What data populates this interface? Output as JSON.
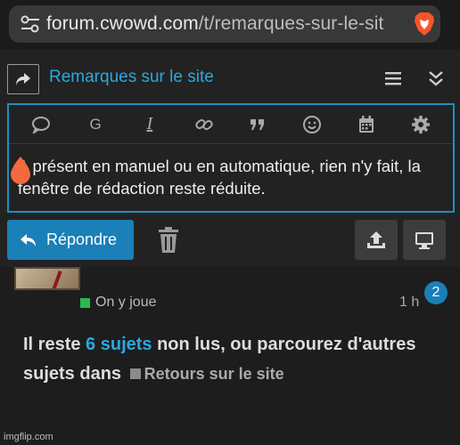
{
  "browser": {
    "url_domain": "forum.cwowd.com",
    "url_path": "/t/remarques-sur-le-sit",
    "icons": [
      "tune-icon",
      "brave-lion-icon"
    ]
  },
  "composer": {
    "topic_title": "Remarques sur le site",
    "header_icons": [
      "reply-arrow-icon",
      "menu-icon",
      "collapse-icon"
    ],
    "toolbar": {
      "items": [
        "quote-icon",
        "G",
        "I",
        "link-icon",
        "blockquote-icon",
        "emoji-icon",
        "calendar-icon",
        "gear-icon"
      ],
      "g_label": "G",
      "i_label": "I"
    },
    "body_text": "A présent en manuel ou en automatique, rien n'y fait, la fenêtre de rédaction reste réduite.",
    "reply_label": "Répondre"
  },
  "topic_list": {
    "category": "On y joue",
    "category_color": "#2db84c",
    "time": "1 h",
    "reply_count": "2"
  },
  "suggestion": {
    "prefix": "Il reste ",
    "link": "6 sujets",
    "middle": " non lus, ou parcourez d'autres sujets dans ",
    "category": "Retours sur le site"
  },
  "watermark": "imgflip.com",
  "colors": {
    "accent": "#1b7fb8",
    "link": "#2aa8e0",
    "background": "#222222"
  }
}
